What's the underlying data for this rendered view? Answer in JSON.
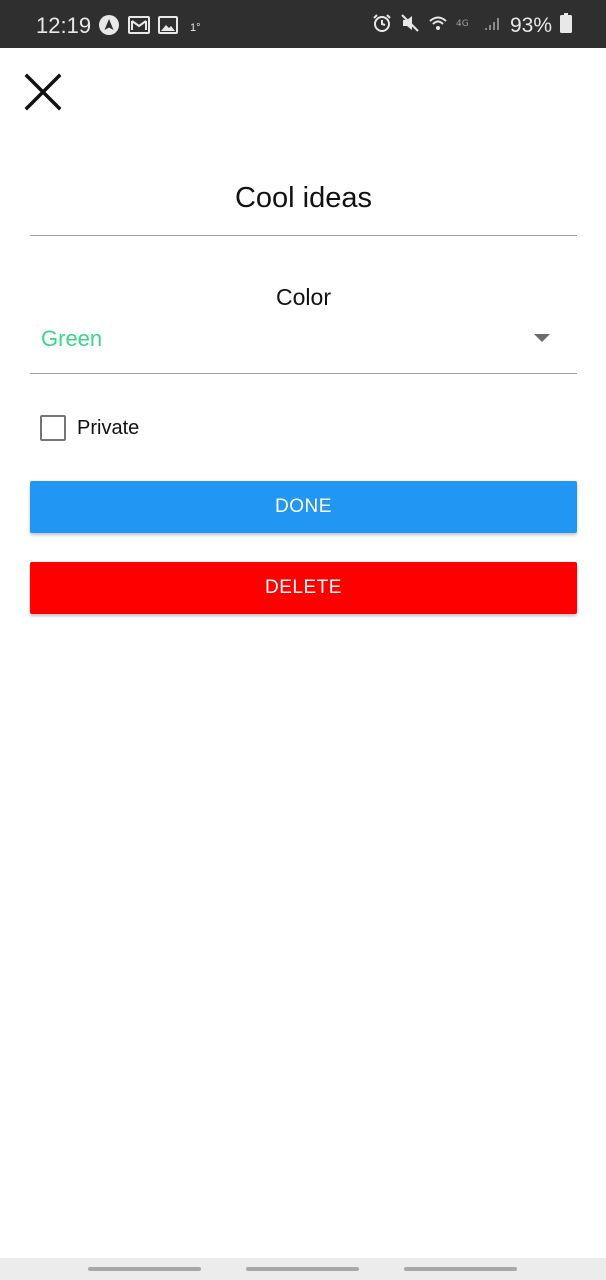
{
  "status_bar": {
    "time": "12:19",
    "small_indicator": "1°",
    "battery_percent": "93%",
    "icons": [
      "navigation-icon",
      "gmail-icon",
      "gallery-icon",
      "alarm-icon",
      "mute-icon",
      "wifi-icon",
      "lte-icon",
      "signal-icon",
      "battery-icon"
    ]
  },
  "header": {
    "close_icon": "close-icon"
  },
  "form": {
    "title": "Cool ideas",
    "color_label": "Color",
    "color_value": "Green",
    "color_value_color": "#36d989",
    "private_label": "Private",
    "private_checked": false
  },
  "buttons": {
    "done_label": "DONE",
    "done_color": "#2196f3",
    "delete_label": "DELETE",
    "delete_color": "#ff0000"
  }
}
